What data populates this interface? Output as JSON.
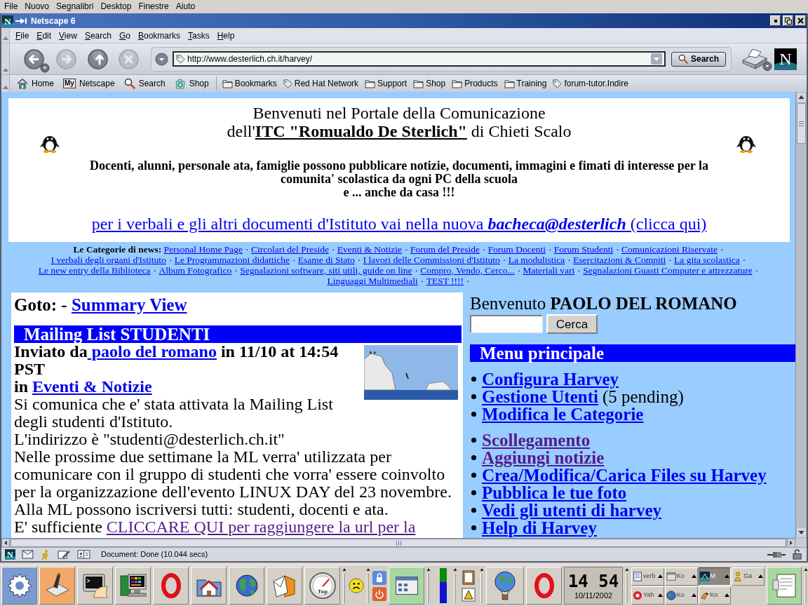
{
  "desktop_menu": {
    "items": [
      "File",
      "Nuovo",
      "Segnalibri",
      "Desktop",
      "Finestre",
      "Aiuto"
    ]
  },
  "window": {
    "title": "Netscape 6",
    "icon_letter": "N"
  },
  "menu_bar": {
    "items": [
      "File",
      "Edit",
      "View",
      "Search",
      "Go",
      "Bookmarks",
      "Tasks",
      "Help"
    ]
  },
  "navigation_toolbar": {
    "buttons": [
      {
        "kind": "back",
        "disabled": false
      },
      {
        "kind": "forward",
        "disabled": true
      },
      {
        "kind": "reload",
        "disabled": false
      },
      {
        "kind": "stop",
        "disabled": true
      }
    ],
    "url": "http://www.desterlich.ch.it/harvey/",
    "search_button": "Search",
    "logo_letter": "N"
  },
  "personal_toolbar": {
    "buttons": [
      {
        "kind": "home",
        "label": "Home"
      },
      {
        "kind": "my",
        "badge": "My",
        "label": "Netscape"
      },
      {
        "kind": "search",
        "label": "Search"
      },
      {
        "kind": "shop",
        "label": "Shop"
      }
    ],
    "bookmarks": [
      {
        "kind": "folder",
        "label": "Bookmarks"
      },
      {
        "kind": "link",
        "label": "Red Hat Network"
      },
      {
        "kind": "folder",
        "label": "Support"
      },
      {
        "kind": "folder",
        "label": "Shop"
      },
      {
        "kind": "folder",
        "label": "Products"
      },
      {
        "kind": "folder",
        "label": "Training"
      },
      {
        "kind": "link",
        "label": "forum-tutor.Indire"
      }
    ]
  },
  "page": {
    "header": {
      "title": "Benvenuti nel Portale della Comunicazione",
      "subtitle": "dell'**ITC \"Romualdo De Sterlich\"** di Chieti Scalo",
      "intro": "Docenti, alunni, personale ata, famiglie possono pubblicare notizie, documenti, immagini e fimati di interesse per la comunita' scolastica da ogni PC della scuola\ne ... anche da casa !!!",
      "bacheca_link": "per i verbali e gli altri documenti d'Istituto vai nella nuova **bacheca@desterlich** (clicca qui)"
    },
    "categories": {
      "label": "Le Categorie di news:",
      "separator": "·",
      "links": [
        "Personal Home Page",
        "Circolari del Preside",
        "Eventi & Notizie",
        "Forum del Preside",
        "Forum Docenti",
        "Forum Studenti",
        "Comunicazioni Riservate",
        "I verbali degli organi d'Istituto",
        "Le Programmazioni didattiche",
        "Esame di Stato",
        "I lavori delle Commissioni d'Istituto",
        "La modulistica",
        "Esercitazioni & Compiti",
        "La gita scolastica",
        "Le new entry della Biblioteca",
        "Album Fotografico",
        "Segnalazioni software, siti utili, guide on line",
        "Compro, Vendo, Cerco...",
        "Materiali vari",
        "Segnalazioni Guasti Computer e attrezzature",
        "Linguaggi Multimediali",
        "TEST !!!!"
      ]
    },
    "article": {
      "goto": [
        {
          "kind": "text",
          "text": "Goto: - "
        },
        {
          "kind": "link",
          "text": "Summary View",
          "visited": false
        }
      ],
      "section_title": "Mailing List STUDENTI",
      "lead": [
        {
          "kind": "byline",
          "runs": [
            {
              "kind": "text",
              "text": "Inviato da"
            },
            {
              "kind": "link",
              "text": " paolo del romano",
              "visited": false
            },
            {
              "kind": "text",
              "text": " in 11/10 at 14:54 PST"
            }
          ]
        },
        {
          "kind": "byline",
          "runs": [
            {
              "kind": "text",
              "text": "in "
            },
            {
              "kind": "link",
              "text": "Eventi & Notizie",
              "visited": false
            }
          ]
        },
        {
          "kind": "text",
          "runs": [
            {
              "kind": "text",
              "text": "Si comunica che e' stata attivata la Mailing List degli studenti d'Istituto."
            }
          ]
        }
      ],
      "body": [
        {
          "kind": "text",
          "runs": [
            {
              "kind": "text",
              "text": "L'indirizzo è \"studenti@desterlich.ch.it\""
            }
          ]
        },
        {
          "kind": "text",
          "runs": [
            {
              "kind": "text",
              "text": "Nelle prossime due settimane la ML verra' utilizzata per comunicare con il gruppo di studenti che vorra' essere coinvolto per la organizzazione dell'evento LINUX DAY del 23 novembre."
            }
          ]
        },
        {
          "kind": "text",
          "runs": [
            {
              "kind": "text",
              "text": "Alla ML possono iscriversi tutti: studenti, docenti e ata."
            }
          ]
        },
        {
          "kind": "text",
          "runs": [
            {
              "kind": "text",
              "text": "E' sufficiente "
            },
            {
              "kind": "link",
              "text": "CLICCARE QUI per raggiungere la url per la",
              "visited": true
            }
          ]
        }
      ]
    },
    "sidebar": {
      "welcome": "Benvenuto **PAOLO DEL ROMANO**",
      "search_button": "Cerca",
      "menu_title": "Menu principale",
      "groups": [
        {
          "items": [
            {
              "label": "Configura Harvey",
              "visited": false
            },
            {
              "label": "Gestione Utenti",
              "visited": false,
              "note": "(5 pending)"
            },
            {
              "label": "Modifica le Categorie",
              "visited": false
            }
          ]
        },
        {
          "items": [
            {
              "label": "Scollegamento",
              "visited": true
            },
            {
              "label": "Aggiungi notizie",
              "visited": true
            },
            {
              "label": "Crea/Modifica/Carica Files su Harvey",
              "visited": false
            },
            {
              "label": "Pubblica le tue foto",
              "visited": false
            },
            {
              "label": "Vedi gli utenti di harvey",
              "visited": false
            },
            {
              "label": "Help di Harvey",
              "visited": false
            }
          ]
        }
      ]
    }
  },
  "status_bar": {
    "logo_letter": "N",
    "text": "Document: Done (10.044 secs)"
  },
  "taskbar": {
    "gauge_text": "Top",
    "clock": {
      "time": "14 54",
      "date": "10/11/2002"
    },
    "tasks": [
      {
        "kind": "document",
        "label": "verb",
        "selected": false
      },
      {
        "kind": "window",
        "label": "Ko",
        "selected": false
      },
      {
        "kind": "browser",
        "label": "M",
        "selected": true
      },
      {
        "kind": "figure",
        "label": "Ga",
        "selected": false
      },
      {
        "kind": "yahoo",
        "label": "Yah",
        "selected": false
      },
      {
        "kind": "globe",
        "label": "Ko",
        "selected": false
      },
      {
        "kind": "news",
        "label": "Kn",
        "selected": false
      }
    ]
  }
}
